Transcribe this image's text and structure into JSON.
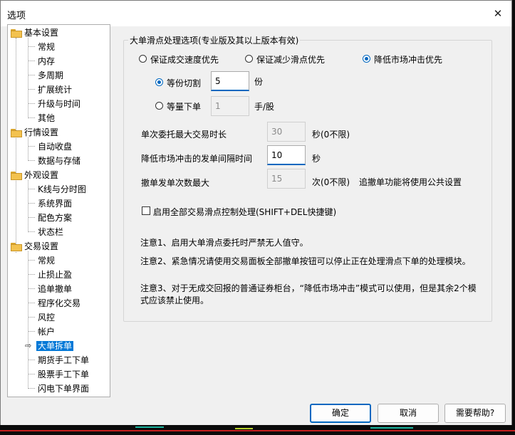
{
  "window": {
    "title": "选项"
  },
  "tree": {
    "groups": [
      {
        "label": "基本设置",
        "children": [
          "常规",
          "内存",
          "多周期",
          "扩展统计",
          "升级与时间",
          "其他"
        ]
      },
      {
        "label": "行情设置",
        "children": [
          "自动收盘",
          "数据与存储"
        ]
      },
      {
        "label": "外观设置",
        "children": [
          "K线与分时图",
          "系统界面",
          "配色方案",
          "状态栏"
        ]
      },
      {
        "label": "交易设置",
        "children": [
          "常规",
          "止损止盈",
          "追单撤单",
          "程序化交易",
          "风控",
          "帐户",
          "大单拆单",
          "期货手工下单",
          "股票手工下单",
          "闪电下单界面"
        ]
      }
    ],
    "selected": "大单拆单"
  },
  "panel": {
    "group_title": "大单滑点处理选项(专业版及其以上版本有效)",
    "priority": {
      "options": [
        "保证成交速度优先",
        "保证减少滑点优先",
        "降低市场冲击优先"
      ],
      "selected": "降低市场冲击优先"
    },
    "split_mode": {
      "equal_parts": {
        "label": "等份切割",
        "value": "5",
        "unit": "份"
      },
      "equal_qty": {
        "label": "等量下单",
        "value": "1",
        "unit": "手/股"
      },
      "selected": "等份切割"
    },
    "max_duration": {
      "label": "单次委托最大交易时长",
      "value": "30",
      "unit": "秒(0不限)"
    },
    "interval": {
      "label": "降低市场冲击的发单间隔时间",
      "value": "10",
      "unit": "秒"
    },
    "max_cancel": {
      "label": "撤单发单次数最大",
      "value": "15",
      "unit": "次(0不限)",
      "hint": "追撤单功能将使用公共设置"
    },
    "enable_all": {
      "label": "启用全部交易滑点控制处理(SHIFT+DEL快捷键)",
      "checked": false
    },
    "notes": [
      "注意1、启用大单滑点委托时严禁无人值守。",
      "注意2、紧急情况请使用交易面板全部撤单按钮可以停止正在处理滑点下单的处理模块。",
      "注意3、对于无成交回报的普通证券柜台，“降低市场冲击”模式可以使用，但是其余2个模式应该禁止使用。"
    ]
  },
  "buttons": {
    "ok": "确定",
    "cancel": "取消",
    "help": "需要帮助?"
  }
}
